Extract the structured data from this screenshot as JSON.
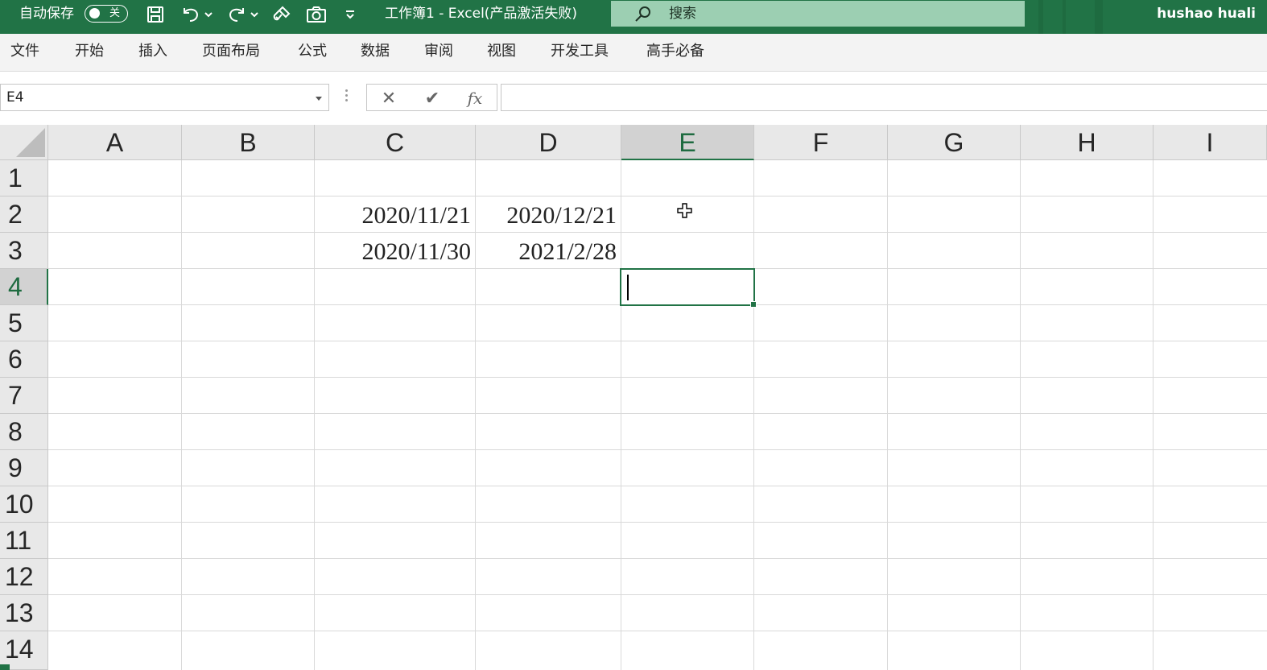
{
  "titlebar": {
    "autosave_label": "自动保存",
    "autosave_state": "关",
    "document_title": "工作簿1  -  Excel(产品激活失败)",
    "search_placeholder": "搜索",
    "user_name": "hushao huali",
    "icons": [
      "save-icon",
      "undo-icon",
      "redo-icon",
      "format-painter-icon",
      "camera-icon",
      "customize-toolbar-icon",
      "search-icon"
    ],
    "accent": "#217346"
  },
  "menu": {
    "items": [
      "文件",
      "开始",
      "插入",
      "页面布局",
      "公式",
      "数据",
      "审阅",
      "视图",
      "开发工具",
      "高手必备"
    ]
  },
  "formula_bar": {
    "name_box": "E4",
    "cancel_icon": "✕",
    "enter_icon": "✔",
    "fx_label": "fx",
    "content": ""
  },
  "sheet": {
    "columns": [
      "A",
      "B",
      "C",
      "D",
      "E",
      "F",
      "G",
      "H",
      "I"
    ],
    "rows": [
      "1",
      "2",
      "3",
      "4",
      "5",
      "6",
      "7",
      "8",
      "9",
      "10",
      "11",
      "12",
      "13",
      "14"
    ],
    "selected_column": "E",
    "selected_row": "4",
    "active_cell": "E4",
    "cells": {
      "C2": "2020/11/21",
      "D2": "2020/12/21",
      "C3": "2020/11/30",
      "D3": "2021/2/28"
    }
  }
}
